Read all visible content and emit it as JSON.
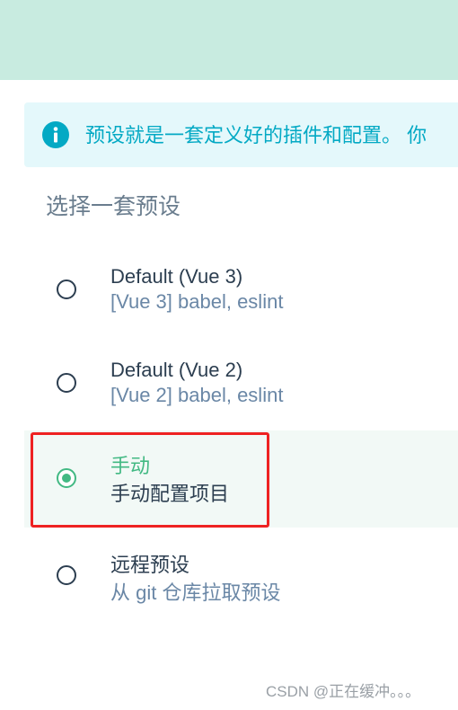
{
  "info_banner": {
    "icon": "info-icon",
    "text": "预设就是一套定义好的插件和配置。 你"
  },
  "section_title": "选择一套预设",
  "presets": [
    {
      "name": "Default (Vue 3)",
      "description": "[Vue 3] babel, eslint",
      "selected": false
    },
    {
      "name": "Default (Vue 2)",
      "description": "[Vue 2] babel, eslint",
      "selected": false
    },
    {
      "name": "手动",
      "description": "手动配置项目",
      "selected": true
    },
    {
      "name": "远程预设",
      "description": "从 git 仓库拉取预设",
      "selected": false
    }
  ],
  "watermark": "CSDN @正在缓冲。。。",
  "colors": {
    "accent": "#42b983",
    "info": "#03a9c4",
    "highlight_box": "#ee2222",
    "top_band": "#c8ebe0"
  }
}
